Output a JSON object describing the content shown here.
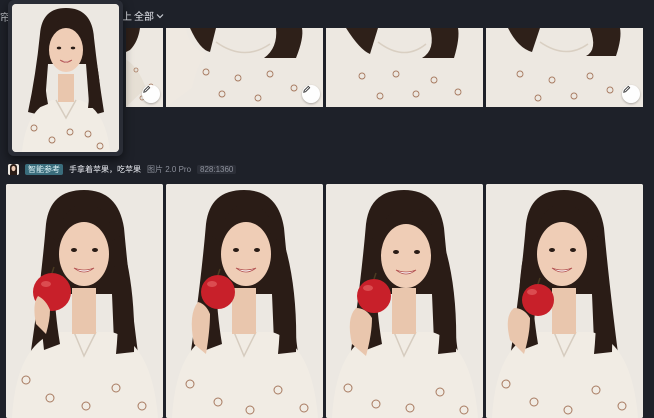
{
  "header": {
    "edge_char": "帘",
    "filter_prefix": "上",
    "filter_label": "全部",
    "filter_chevron": "chevron-down-icon"
  },
  "reference_popup": {
    "image": "reference-portrait"
  },
  "top_row": {
    "thumbnails": [
      {
        "image": "pajama-crop",
        "action": "edit-icon"
      },
      {
        "image": "pajama-crop",
        "action": "edit-icon"
      },
      {
        "image": "pajama-crop",
        "action": "edit-icon"
      },
      {
        "image": "pajama-crop",
        "action": "edit-icon"
      }
    ]
  },
  "generation": {
    "mode_badge": "智能参考",
    "prompt": "手拿着苹果，吃苹果",
    "model": "图片 2.0 Pro",
    "size": "828:1360"
  },
  "results": [
    {
      "image": "woman-holding-apple"
    },
    {
      "image": "woman-holding-apple"
    },
    {
      "image": "woman-holding-apple"
    },
    {
      "image": "woman-holding-apple"
    }
  ],
  "colors": {
    "background": "#1e2129",
    "badge": "#3a6d7c",
    "apple": "#c8202a",
    "hair": "#2a1c16",
    "pajama": "#f1ece4"
  }
}
